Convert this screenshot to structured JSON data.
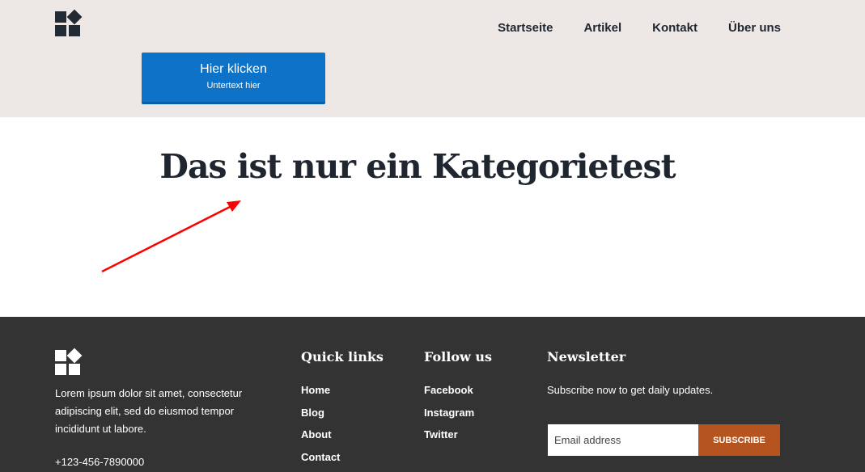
{
  "header": {
    "logo_icon": "blocks-logo-icon",
    "nav": [
      {
        "label": "Startseite"
      },
      {
        "label": "Artikel"
      },
      {
        "label": "Kontakt"
      },
      {
        "label": "Über uns"
      }
    ],
    "cta": {
      "label": "Hier klicken",
      "sublabel": "Untertext hier",
      "color": "#0d73c9"
    }
  },
  "main": {
    "title": "Das ist nur ein Kategorietest",
    "annotation_arrow_color": "#ff0000"
  },
  "footer": {
    "logo_icon": "blocks-logo-icon",
    "about": "Lorem ipsum dolor sit amet, consectetur adipiscing elit, sed do eiusmod tempor incididunt ut labore.",
    "phone": "+123-456-7890000",
    "quick_links": {
      "heading": "Quick links",
      "items": [
        {
          "label": "Home"
        },
        {
          "label": "Blog"
        },
        {
          "label": "About"
        },
        {
          "label": "Contact"
        }
      ]
    },
    "follow_us": {
      "heading": "Follow us",
      "items": [
        {
          "label": "Facebook"
        },
        {
          "label": "Instagram"
        },
        {
          "label": "Twitter"
        }
      ]
    },
    "newsletter": {
      "heading": "Newsletter",
      "text": "Subscribe now to get daily updates.",
      "email_placeholder": "Email address",
      "button_label": "SUBSCRIBE",
      "button_color": "#b5541f"
    }
  }
}
